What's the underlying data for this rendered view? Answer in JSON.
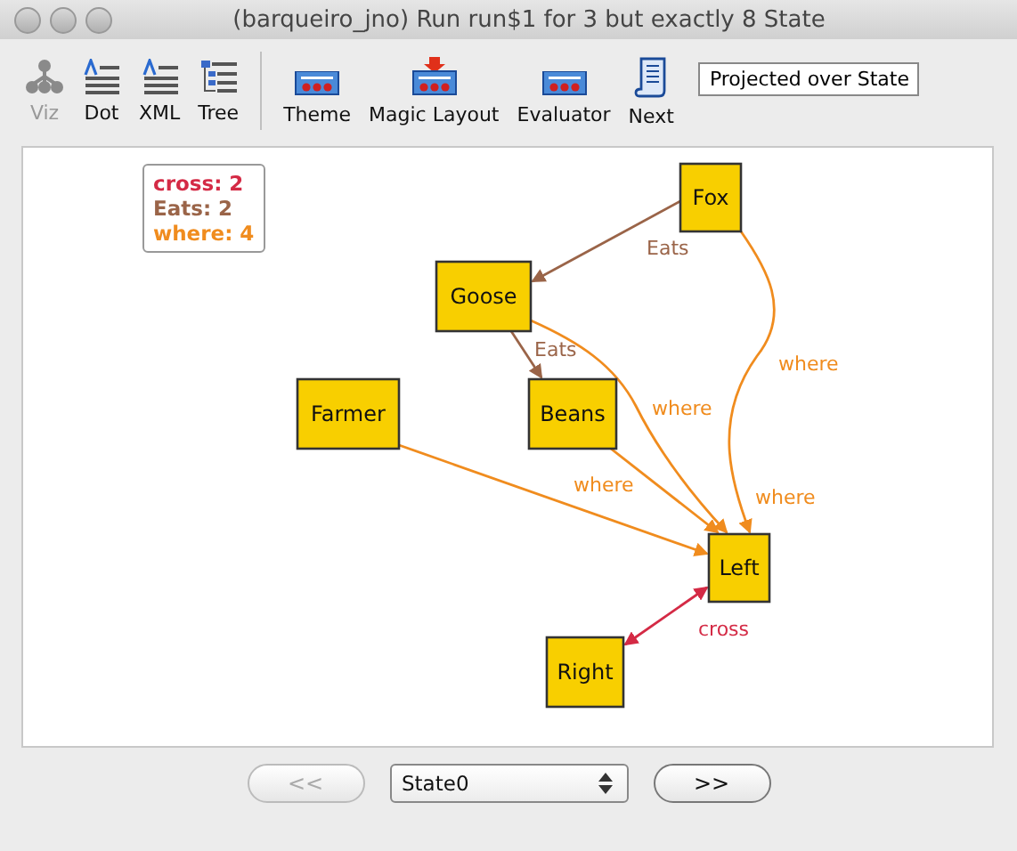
{
  "window": {
    "title": "(barqueiro_jno) Run run$1 for 3 but exactly 8 State"
  },
  "toolbar": {
    "items": [
      {
        "label": "Viz",
        "kind": "viz",
        "disabled": true
      },
      {
        "label": "Dot",
        "kind": "doc",
        "disabled": false
      },
      {
        "label": "XML",
        "kind": "doc",
        "disabled": false
      },
      {
        "label": "Tree",
        "kind": "tree",
        "disabled": false
      },
      {
        "label": "Theme",
        "kind": "panel",
        "disabled": false
      },
      {
        "label": "Magic Layout",
        "kind": "magic",
        "disabled": false
      },
      {
        "label": "Evaluator",
        "kind": "panel",
        "disabled": false
      },
      {
        "label": "Next",
        "kind": "scroll",
        "disabled": false
      }
    ],
    "projection": "Projected over State"
  },
  "legend": [
    {
      "text": "cross: 2",
      "color": "#d42a45"
    },
    {
      "text": "Eats: 2",
      "color": "#9a6448"
    },
    {
      "text": "where: 4",
      "color": "#f08c1e"
    }
  ],
  "graph": {
    "nodes": [
      {
        "label": "Fox"
      },
      {
        "label": "Goose"
      },
      {
        "label": "Farmer"
      },
      {
        "label": "Beans"
      },
      {
        "label": "Left"
      },
      {
        "label": "Right"
      }
    ],
    "edges": [
      {
        "label": "Eats",
        "color": "#9a6448",
        "both_ends": false
      },
      {
        "label": "Eats",
        "color": "#9a6448",
        "both_ends": false
      },
      {
        "label": "where",
        "color": "#f08c1e",
        "both_ends": false
      },
      {
        "label": "where",
        "color": "#f08c1e",
        "both_ends": false
      },
      {
        "label": "where",
        "color": "#f08c1e",
        "both_ends": false
      },
      {
        "label": "where",
        "color": "#f08c1e",
        "both_ends": false
      },
      {
        "label": "cross",
        "color": "#d42a45",
        "both_ends": true
      }
    ]
  },
  "navigation": {
    "previous": {
      "label": "<<",
      "disabled": true
    },
    "state": "State0",
    "next": {
      "label": ">>",
      "disabled": false
    }
  }
}
